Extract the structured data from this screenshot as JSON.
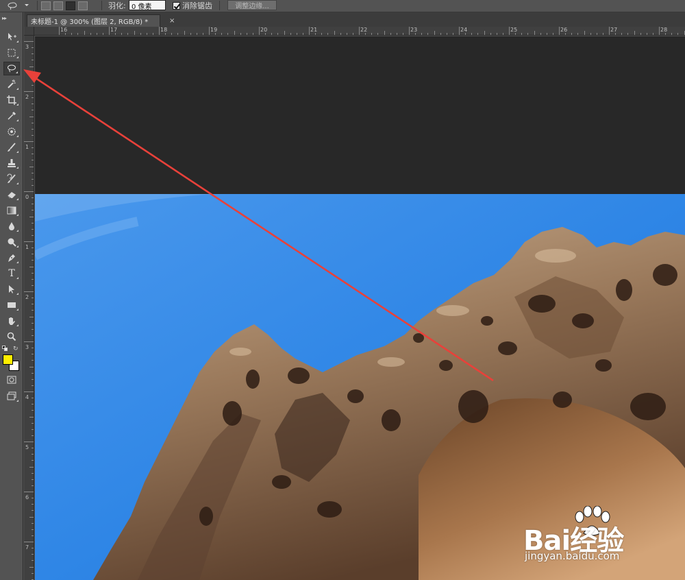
{
  "options_bar": {
    "feather_label": "羽化:",
    "feather_value": "0 像素",
    "antialias_label": "消除锯齿",
    "antialias_checked": true,
    "refine_edge_label": "调整边缘..."
  },
  "document": {
    "tab_title": "未标题-1 @ 300% (图层 2, RGB/8) *",
    "close_glyph": "×"
  },
  "ruler": {
    "horizontal": [
      "16",
      "17",
      "18",
      "19",
      "20",
      "21",
      "22",
      "23",
      "24",
      "25",
      "26",
      "27",
      "28"
    ],
    "vertical": [
      "3",
      "2",
      "1",
      "0",
      "1",
      "2",
      "3",
      "4",
      "5",
      "6",
      "7"
    ]
  },
  "tools": [
    {
      "id": "move",
      "icon": "move-icon"
    },
    {
      "id": "marquee",
      "icon": "rect-marquee-icon"
    },
    {
      "id": "lasso",
      "icon": "lasso-icon",
      "active": true
    },
    {
      "id": "magic-wand",
      "icon": "magic-wand-icon"
    },
    {
      "id": "crop",
      "icon": "crop-icon"
    },
    {
      "id": "eyedropper",
      "icon": "eyedropper-icon"
    },
    {
      "id": "healing",
      "icon": "healing-brush-icon"
    },
    {
      "id": "brush",
      "icon": "brush-icon"
    },
    {
      "id": "stamp",
      "icon": "clone-stamp-icon"
    },
    {
      "id": "history-brush",
      "icon": "history-brush-icon"
    },
    {
      "id": "eraser",
      "icon": "eraser-icon"
    },
    {
      "id": "gradient",
      "icon": "gradient-icon"
    },
    {
      "id": "blur",
      "icon": "blur-icon"
    },
    {
      "id": "dodge",
      "icon": "dodge-icon"
    },
    {
      "id": "pen",
      "icon": "pen-icon"
    },
    {
      "id": "type",
      "icon": "type-icon",
      "glyph": "T"
    },
    {
      "id": "path-select",
      "icon": "path-selection-icon"
    },
    {
      "id": "shape",
      "icon": "rectangle-shape-icon"
    },
    {
      "id": "hand",
      "icon": "hand-icon"
    },
    {
      "id": "zoom",
      "icon": "zoom-icon"
    }
  ],
  "colors": {
    "foreground": "#ffee00",
    "background": "#ffffff",
    "annotation_arrow": "#e8413a",
    "sky": "#2f86e6"
  },
  "watermark": {
    "brand": "Bai经验",
    "url": "jingyan.baidu.com"
  }
}
